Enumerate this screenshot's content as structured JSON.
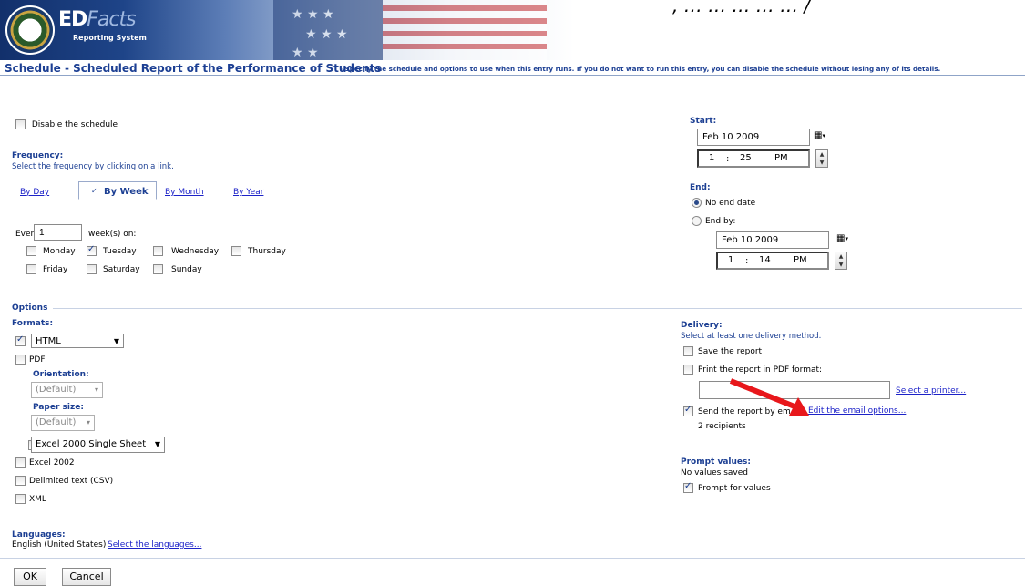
{
  "banner": {
    "brand_main": "ED",
    "brand_accent": "Facts",
    "brand_sub": "Reporting System",
    "quote_fragment": ", …   …   …   …   …   /"
  },
  "header": {
    "title": "Schedule - Scheduled Report of the Performance of Students",
    "description": " - Specify the schedule and options to use when this entry runs. If you do not want to run this entry, you can disable the schedule without losing any of its details."
  },
  "schedule": {
    "disable_label": "Disable the schedule",
    "frequency_heading": "Frequency:",
    "frequency_hint": "Select the frequency by clicking on a link.",
    "tabs": [
      {
        "label": "By Day",
        "selected": false
      },
      {
        "label": "By Week",
        "selected": true
      },
      {
        "label": "By Month",
        "selected": false
      },
      {
        "label": "By Year",
        "selected": false
      }
    ],
    "every_label": "Every",
    "every_value": "1",
    "every_suffix": "week(s) on:",
    "days": [
      {
        "label": "Monday",
        "checked": false
      },
      {
        "label": "Tuesday",
        "checked": true
      },
      {
        "label": "Wednesday",
        "checked": false
      },
      {
        "label": "Thursday",
        "checked": false
      },
      {
        "label": "Friday",
        "checked": false
      },
      {
        "label": "Saturday",
        "checked": false
      },
      {
        "label": "Sunday",
        "checked": false
      }
    ]
  },
  "start": {
    "heading": "Start:",
    "date": "Feb 10 2009",
    "hour": "1",
    "sep": ":",
    "minute": "25",
    "ampm": "PM"
  },
  "end": {
    "heading": "End:",
    "no_end_label": "No end date",
    "end_by_label": "End by:",
    "selected": "No end date",
    "date": "Feb 10 2009",
    "hour": "1",
    "sep": ":",
    "minute": "14",
    "ampm": "PM"
  },
  "options": {
    "heading": "Options",
    "formats_heading": "Formats:",
    "html_format": "HTML",
    "pdf_label": "PDF",
    "orientation_heading": "Orientation:",
    "orientation_value": "(Default)",
    "paper_heading": "Paper size:",
    "paper_value": "(Default)",
    "excel_format": "Excel 2000 Single Sheet",
    "excel2002_label": "Excel 2002",
    "csv_label": "Delimited text (CSV)",
    "xml_label": "XML",
    "languages_heading": "Languages:",
    "languages_value": "English (United States)",
    "languages_link": "Select the languages..."
  },
  "delivery": {
    "heading": "Delivery:",
    "hint": "Select at least one delivery method.",
    "save_label": "Save the report",
    "print_label": "Print the report in PDF format:",
    "printer_value": "",
    "printer_link": "Select a printer...",
    "email_label": "Send the report by em",
    "email_link": "Edit the email options...",
    "recipients": "2 recipients"
  },
  "prompt": {
    "heading": "Prompt values:",
    "status": "No values saved",
    "prompt_label": "Prompt for values"
  },
  "footer": {
    "ok_label": "OK",
    "cancel_label": "Cancel"
  },
  "colors": {
    "accent": "#1c3f93",
    "link": "#1c22c8",
    "arrow": "#e8171b"
  },
  "icons": {
    "calendar": "calendar-icon",
    "spinner": "spin-icon",
    "dropdown": "chevron-down-icon"
  }
}
